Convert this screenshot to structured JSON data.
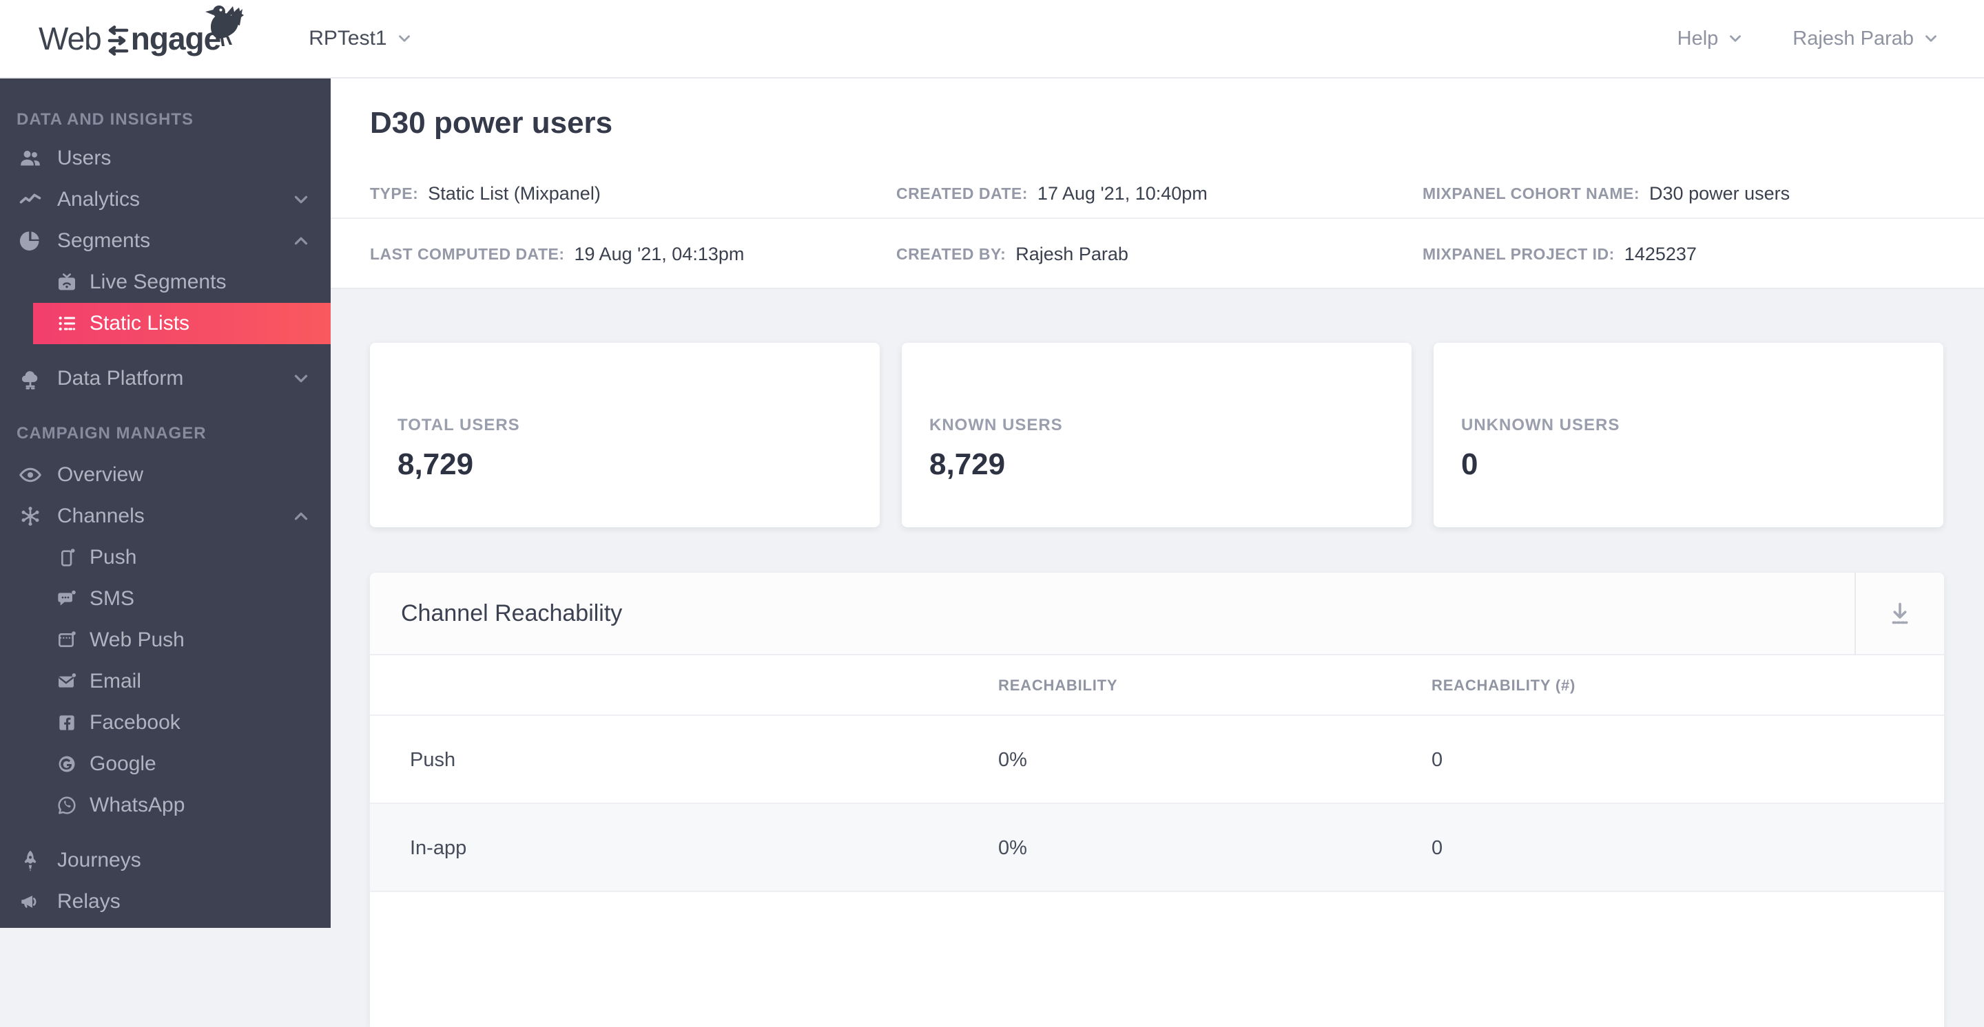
{
  "brand": {
    "word_part1": "Web",
    "word_part2": "ngage"
  },
  "topbar": {
    "project": "RPTest1",
    "help_label": "Help",
    "user_name": "Rajesh Parab"
  },
  "colors": {
    "accent": "#f23f6d",
    "accent_gradient_end": "#f9595f",
    "sidebar_bg": "#3e4152"
  },
  "sidebar": {
    "sections": [
      {
        "title": "DATA AND INSIGHTS",
        "items": [
          {
            "label": "Users"
          },
          {
            "label": "Analytics"
          },
          {
            "label": "Segments"
          },
          {
            "label": "Live Segments"
          },
          {
            "label": "Static Lists"
          },
          {
            "label": "Data Platform"
          }
        ]
      },
      {
        "title": "CAMPAIGN MANAGER",
        "items": [
          {
            "label": "Overview"
          },
          {
            "label": "Channels"
          },
          {
            "label": "Push"
          },
          {
            "label": "SMS"
          },
          {
            "label": "Web Push"
          },
          {
            "label": "Email"
          },
          {
            "label": "Facebook"
          },
          {
            "label": "Google"
          },
          {
            "label": "WhatsApp"
          },
          {
            "label": "Journeys"
          },
          {
            "label": "Relays"
          }
        ]
      }
    ]
  },
  "page": {
    "title": "D30 power users"
  },
  "meta": {
    "row1": [
      {
        "label": "TYPE:",
        "value": "Static List (Mixpanel)"
      },
      {
        "label": "CREATED DATE:",
        "value": "17 Aug '21, 10:40pm"
      },
      {
        "label": "MIXPANEL COHORT NAME:",
        "value": "D30 power users"
      }
    ],
    "row2": [
      {
        "label": "LAST COMPUTED DATE:",
        "value": "19 Aug '21, 04:13pm"
      },
      {
        "label": "CREATED BY:",
        "value": "Rajesh Parab"
      },
      {
        "label": "MIXPANEL PROJECT ID:",
        "value": "1425237"
      }
    ]
  },
  "stats": [
    {
      "label": "TOTAL USERS",
      "value": "8,729"
    },
    {
      "label": "KNOWN USERS",
      "value": "8,729"
    },
    {
      "label": "UNKNOWN USERS",
      "value": "0"
    }
  ],
  "reachability": {
    "title": "Channel Reachability",
    "columns": {
      "reachability": "REACHABILITY",
      "reachability_count": "REACHABILITY (#)"
    },
    "rows": [
      {
        "channel": "Push",
        "reachability": "0%",
        "count": "0"
      },
      {
        "channel": "In-app",
        "reachability": "0%",
        "count": "0"
      }
    ]
  }
}
